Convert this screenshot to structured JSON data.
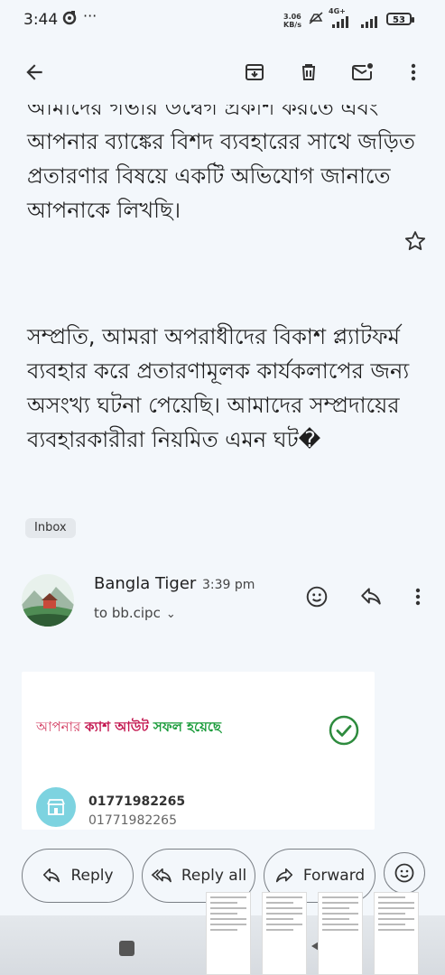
{
  "status_bar": {
    "time": "3:44",
    "speed_value": "3.06",
    "speed_unit": "KB/s",
    "network": "4G+",
    "battery": "53"
  },
  "email": {
    "body_paragraph_1": "আমাদের গভীর উদ্বেগ প্রকাশ করতে এবং আপনার ব্যাঙ্কের বিশদ ব্যবহারের সাথে জড়িত প্রতারণার বিষয়ে একটি অভিযোগ জানাতে আপনাকে লিখছি।",
    "body_paragraph_2": "সম্প্রতি, আমরা অপরাধীদের বিকাশ প্ল্যাটফর্ম ব্যবহার করে প্রতারণামূলক কার্যকলাপের জন্য অসংখ্য ঘটনা পেয়েছি। আমাদের সম্প্রদায়ের ব্যবহারকারীরা নিয়মিত এমন ঘট�",
    "label": "Inbox"
  },
  "message": {
    "sender_name": "Bangla Tiger",
    "time": "3:39 pm",
    "recipient": "to bb.cipc"
  },
  "card": {
    "title_part1": "আপনার ",
    "title_part2": "ক্যাশ আউট ",
    "title_part3": " সফল হয়েছে",
    "number_1": "01771982265",
    "number_2": "01771982265"
  },
  "actions": {
    "reply": "Reply",
    "reply_all": "Reply all",
    "forward": "Forward"
  },
  "colors": {
    "background": "#f3f7fb",
    "card_title_pink": "#c3164f",
    "card_title_green": "#199b3a",
    "check_green": "#2e8b3e"
  }
}
